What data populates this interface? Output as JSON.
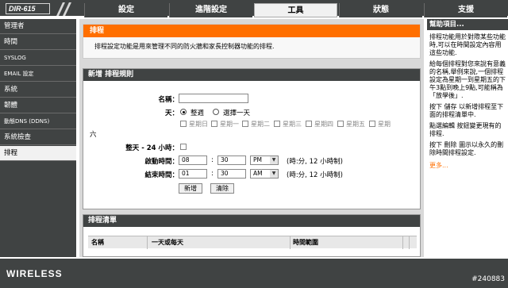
{
  "brand": {
    "model": "DIR-615"
  },
  "nav": {
    "tabs": [
      "設定",
      "進階設定",
      "工具",
      "狀態",
      "支援"
    ],
    "active": 2
  },
  "sidebar": {
    "items": [
      {
        "label": "管理者"
      },
      {
        "label": "時間"
      },
      {
        "label": "SYSLOG"
      },
      {
        "label": "EMAIL 設定"
      },
      {
        "label": "系統"
      },
      {
        "label": "韌體"
      },
      {
        "label": "動態DNS (DDNS)"
      },
      {
        "label": "系統檢查"
      },
      {
        "label": "排程"
      }
    ],
    "active": 8
  },
  "intro": {
    "title": "排程",
    "desc": "排程設定功能是用來管理不同的防火牆和家長控制器功能的排程."
  },
  "rules": {
    "title": "新增 排程規則",
    "name_label": "名稱：",
    "name_value": "",
    "day_label": "天：",
    "radio_week": "整週",
    "radio_select": "選擇一天",
    "days": [
      "星期日",
      "星期一",
      "星期二",
      "星期三",
      "星期四",
      "星期五",
      "星期"
    ],
    "day_overflow": "六",
    "allday_label": "整天 - 24 小時：",
    "start_label": "啟動時間：",
    "start_hour": "08",
    "start_min": "30",
    "start_ampm": "PM",
    "start_hint": "(時:分, 12 小時制)",
    "end_label": "結束時間：",
    "end_hour": "01",
    "end_min": "30",
    "end_ampm": "AM",
    "end_hint": "(時:分, 12 小時制)",
    "colon": ":",
    "add_btn": "新增",
    "clear_btn": "清除"
  },
  "list": {
    "title": "排程清單",
    "col_name": "名稱",
    "col_day": "一天或每天",
    "col_time": "時間範圍"
  },
  "help": {
    "title": "幫助項目...",
    "p1": "排程功能用於對際某些功能時,可以在時間設定內容用這些功能.",
    "p2": "給每個排程對您來說有意義的名稱,舉例來說,一個排程設定為星期一到星期五的下午3點到晚上9點,可能稱為「放學後」.",
    "p3": "按下 儲存 以新增排程至下面的排程清單中.",
    "p4": "點選編輯 按鈕變更現有的排程.",
    "p5": "按下 刪除 圖示以永久的刪除時間排程設定.",
    "more": "更多..."
  },
  "footer": {
    "logo": "WIRELESS",
    "id": "#240883"
  }
}
